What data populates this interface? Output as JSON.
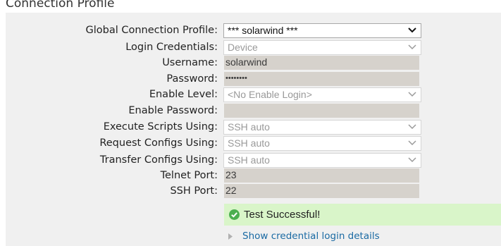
{
  "section_title": "Connection Profile",
  "form": {
    "global_profile": {
      "label": "Global Connection Profile:",
      "value": "*** solarwind ***"
    },
    "login_credentials": {
      "label": "Login Credentials:",
      "value": "Device"
    },
    "username": {
      "label": "Username:",
      "value": "solarwind"
    },
    "password": {
      "label": "Password:",
      "value": "••••••••"
    },
    "enable_level": {
      "label": "Enable Level:",
      "value": "<No Enable Login>"
    },
    "enable_password": {
      "label": "Enable Password:",
      "value": ""
    },
    "execute_scripts": {
      "label": "Execute Scripts Using:",
      "value": "SSH auto"
    },
    "request_configs": {
      "label": "Request Configs Using:",
      "value": "SSH auto"
    },
    "transfer_configs": {
      "label": "Transfer Configs Using:",
      "value": "SSH auto"
    },
    "telnet_port": {
      "label": "Telnet Port:",
      "value": "23"
    },
    "ssh_port": {
      "label": "SSH Port:",
      "value": "22"
    }
  },
  "test_result": {
    "message": "Test Successful!",
    "icon": "check-circle-icon",
    "color": "#d9f5c9"
  },
  "details_link": {
    "label": "Show credential login details",
    "icon": "triangle-right-icon"
  },
  "colors": {
    "panel_bg": "#f0f0f0",
    "readonly_field_bg": "#d6d2cc",
    "link": "#1a6aa3",
    "success_icon": "#4caf50"
  }
}
